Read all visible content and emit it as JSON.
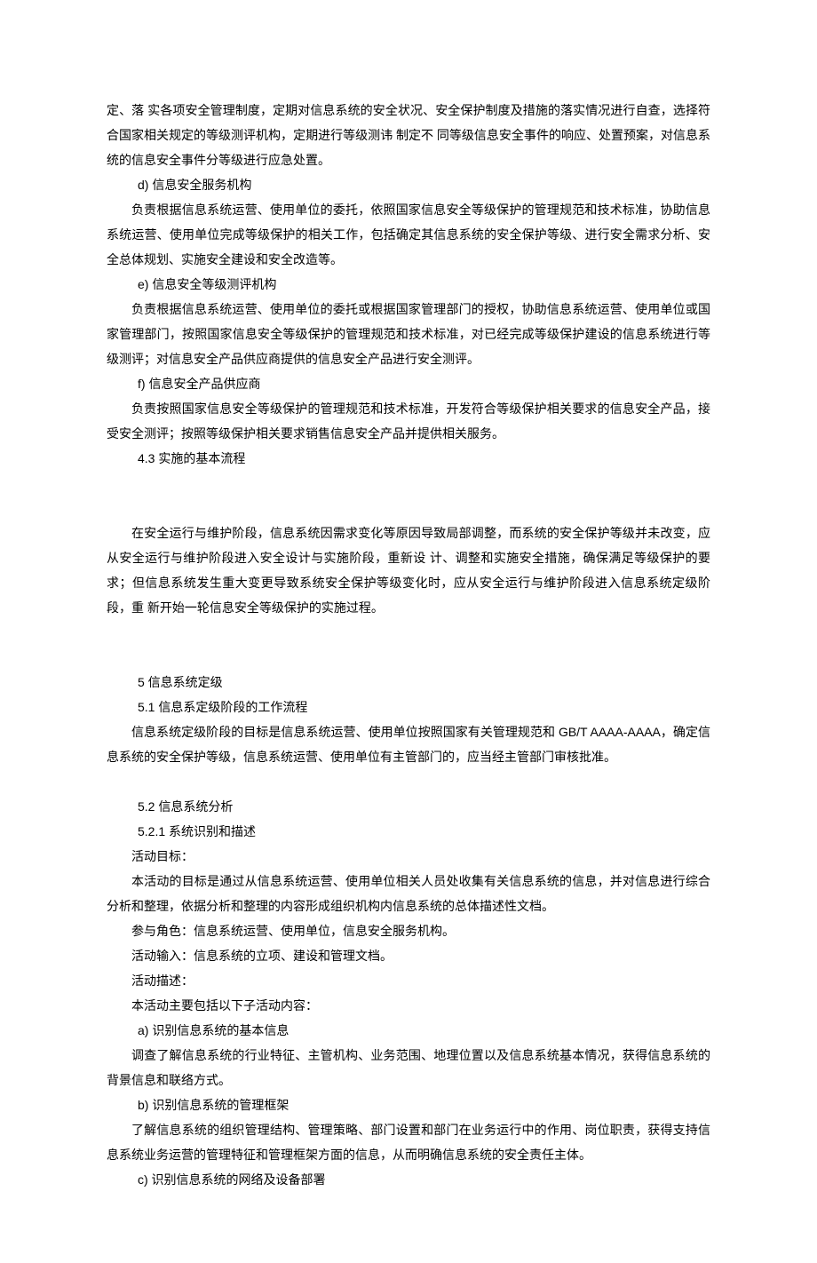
{
  "paragraphs": {
    "p0": "定、落 实各项安全管理制度，定期对信息系统的安全状况、安全保护制度及措施的落实情况进行自查，选择符合国家相关规定的等级测评机构，定期进行等级测讳 制定不 同等级信息安全事件的响应、处置预案，对信息系统的信息安全事件分等级进行应急处置。",
    "d_label": "d)   信息安全服务机构",
    "d_body": "负责根据信息系统运营、使用单位的委托，依照国家信息安全等级保护的管理规范和技术标准，协助信息系统运营、使用单位完成等级保护的相关工作，包括确定其信息系统的安全保护等级、进行安全需求分析、安全总体规划、实施安全建设和安全改造等。",
    "e_label": "e)   信息安全等级测评机构",
    "e_body": "负责根据信息系统运营、使用单位的委托或根据国家管理部门的授权，协助信息系统运营、使用单位或国家管理部门，按照国家信息安全等级保护的管理规范和技术标准，对已经完成等级保护建设的信息系统进行等级测评；对信息安全产品供应商提供的信息安全产品进行安全测评。",
    "f_label": "f)    信息安全产品供应商",
    "f_body": "负责按照国家信息安全等级保护的管理规范和技术标准，开发符合等级保护相关要求的信息安全产品，接受安全测评；按照等级保护相关要求销售信息安全产品并提供相关服务。",
    "s4_3": "4.3  实施的基本流程",
    "p4_3_body": "在安全运行与维护阶段，信息系统因需求变化等原因导致局部调整，而系统的安全保护等级并未改变，应从安全运行与维护阶段进入安全设计与实施阶段，重新设 计、调整和实施安全措施，确保满足等级保护的要求；但信息系统发生重大变更导致系统安全保护等级变化时，应从安全运行与维护阶段进入信息系统定级阶段，重 新开始一轮信息安全等级保护的实施过程。",
    "s5": "5  信息系统定级",
    "s5_1": "5.1  信息系定级阶段的工作流程",
    "p5_1": "信息系统定级阶段的目标是信息系统运营、使用单位按照国家有关管理规范和 GB/T AAAA-AAAA，确定信息系统的安全保护等级，信息系统运营、使用单位有主管部门的，应当经主管部门审核批准。",
    "s5_2": "5.2  信息系统分析",
    "s5_2_1": "5.2.1     系统识别和描述",
    "act_goal_label": "活动目标：",
    "act_goal_body": "本活动的目标是通过从信息系统运营、使用单位相关人员处收集有关信息系统的信息，并对信息进行综合分析和整理，依据分析和整理的内容形成组织机构内信息系统的总体描述性文档。",
    "act_role": "参与角色：信息系统运营、使用单位，信息安全服务机构。",
    "act_input": "活动输入：信息系统的立项、建设和管理文档。",
    "act_desc_label": "活动描述：",
    "act_desc_body": "本活动主要包括以下子活动内容：",
    "a_label": "a)   识别信息系统的基本信息",
    "a_body": "调查了解信息系统的行业特征、主管机构、业务范围、地理位置以及信息系统基本情况，获得信息系统的背景信息和联络方式。",
    "b_label": "b)   识别信息系统的管理框架",
    "b_body": "了解信息系统的组织管理结构、管理策略、部门设置和部门在业务运行中的作用、岗位职责，获得支持信息系统业务运营的管理特征和管理框架方面的信息，从而明确信息系统的安全责任主体。",
    "c_label": "c)   识别信息系统的网络及设备部署"
  }
}
